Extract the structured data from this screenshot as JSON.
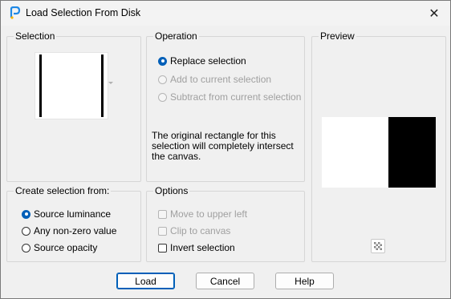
{
  "window": {
    "title": "Load Selection From Disk"
  },
  "selection_group": {
    "label": "Selection"
  },
  "operation_group": {
    "label": "Operation",
    "options": [
      {
        "label": "Replace selection",
        "selected": true,
        "enabled": true
      },
      {
        "label": "Add to current selection",
        "selected": false,
        "enabled": false
      },
      {
        "label": "Subtract from current selection",
        "selected": false,
        "enabled": false
      }
    ],
    "note": "The original rectangle for this selection will completely intersect the canvas."
  },
  "preview_group": {
    "label": "Preview"
  },
  "create_group": {
    "label": "Create selection from:",
    "options": [
      {
        "label": "Source luminance",
        "selected": true
      },
      {
        "label": "Any non-zero value",
        "selected": false
      },
      {
        "label": "Source opacity",
        "selected": false
      }
    ]
  },
  "options_group": {
    "label": "Options",
    "items": [
      {
        "label": "Move to upper left",
        "checked": false,
        "enabled": false
      },
      {
        "label": "Clip to canvas",
        "checked": false,
        "enabled": false
      },
      {
        "label": "Invert selection",
        "checked": false,
        "enabled": true
      }
    ]
  },
  "buttons": {
    "load": "Load",
    "cancel": "Cancel",
    "help": "Help"
  }
}
